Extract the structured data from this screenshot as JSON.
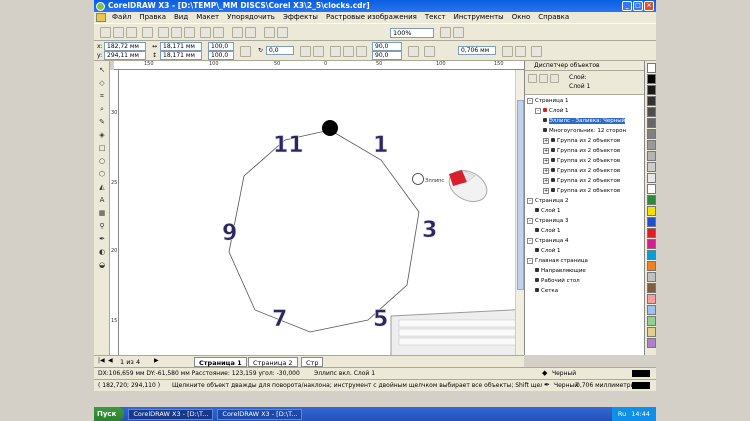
{
  "window": {
    "title": "CorelDRAW X3 - [D:\\TEMP\\_MM DISCS\\Corel X3\\2_5\\clocks.cdr]",
    "buttons": [
      "_",
      "□",
      "×"
    ]
  },
  "menu": [
    "Файл",
    "Правка",
    "Вид",
    "Макет",
    "Упорядочить",
    "Эффекты",
    "Растровые изображения",
    "Текст",
    "Инструменты",
    "Окно",
    "Справка"
  ],
  "toolbar": {
    "zoom": "100%"
  },
  "property_bar": {
    "x": "182,72 мм",
    "y": "294,11 мм",
    "w": "18,171 мм",
    "h": "18,171 мм",
    "scale_x": "100,0",
    "scale_y": "100,0",
    "rotation": "0,0",
    "start_angle": "90,0",
    "end_angle": "90,0",
    "outline_width": "0,706 мм"
  },
  "ruler": {
    "h_ticks": [
      "150",
      "100",
      "50",
      "0",
      "50",
      "100",
      "150"
    ],
    "v_ticks": [
      "30",
      "25",
      "20",
      "15"
    ],
    "unit": "миллиметры"
  },
  "canvas": {
    "numbers": [
      "11",
      "1",
      "3",
      "9",
      "7",
      "5"
    ],
    "cursor_label": "Эллипс"
  },
  "pages": {
    "nav": "1 из 4",
    "tabs": [
      "Страница 1",
      "Страница 2",
      "Стр"
    ]
  },
  "docker": {
    "title": "Диспетчер объектов",
    "layer_label": "Слой:",
    "layer_name": "Слой 1",
    "tree": [
      {
        "text": "Страница 1",
        "level": 0,
        "exp": "-"
      },
      {
        "text": "Слой 1",
        "level": 1,
        "exp": "-",
        "color": "#d02020"
      },
      {
        "text": "Эллипс - Заливка: Черный",
        "level": 2,
        "sel": true
      },
      {
        "text": "Многоугольник: 12 сторон",
        "level": 2
      },
      {
        "text": "Группа из 2 объектов",
        "level": 2,
        "exp": "+"
      },
      {
        "text": "Группа из 2 объектов",
        "level": 2,
        "exp": "+"
      },
      {
        "text": "Группа из 2 объектов",
        "level": 2,
        "exp": "+"
      },
      {
        "text": "Группа из 2 объектов",
        "level": 2,
        "exp": "+"
      },
      {
        "text": "Группа из 2 объектов",
        "level": 2,
        "exp": "+"
      },
      {
        "text": "Группа из 2 объектов",
        "level": 2,
        "exp": "+"
      },
      {
        "text": "Страница 2",
        "level": 0,
        "exp": "-"
      },
      {
        "text": "Слой 1",
        "level": 1
      },
      {
        "text": "Страница 3",
        "level": 0,
        "exp": "-"
      },
      {
        "text": "Слой 1",
        "level": 1
      },
      {
        "text": "Страница 4",
        "level": 0,
        "exp": "-"
      },
      {
        "text": "Слой 1",
        "level": 1
      },
      {
        "text": "Главная страница",
        "level": 0,
        "exp": "-"
      },
      {
        "text": "Направляющие",
        "level": 1
      },
      {
        "text": "Рабочий стол",
        "level": 1
      },
      {
        "text": "Сетка",
        "level": 1
      }
    ]
  },
  "palette": [
    "#ffffff",
    "#000000",
    "#1a1a1a",
    "#333333",
    "#4d4d4d",
    "#666666",
    "#808080",
    "#999999",
    "#b3b3b3",
    "#cccccc",
    "#e6e6e6",
    "#ffffff",
    "#2b8a3e",
    "#f5e000",
    "#1f4fd0",
    "#e02020",
    "#d51e8f",
    "#00a0e0",
    "#f08020",
    "#c0c0c0",
    "#7f5f3f",
    "#f4a0a0",
    "#a0c0f0",
    "#90d090",
    "#e0d090",
    "#b080d0"
  ],
  "status": {
    "line1_left": "DX:106,659 мм DY:-61,580 мм Расстояние: 123,159 угол: -30,000",
    "line1_mid": "Эллипс вкл. Слой 1",
    "fill_label": "Черный",
    "line2_left": "( 182,720; 294,110 )",
    "line2_hint": "Щелкните объект дважды для поворота/наклона; инструмент с двойным щелчком выбирает все объекты; Shift щелчок - выбор не...",
    "outline_label": "Черный",
    "outline_width": "0,706 миллиметры"
  },
  "taskbar": {
    "start": "Пуск",
    "items": [
      "CorelDRAW X3 - [D:\\T...",
      "CorelDRAW X3 - [D:\\T..."
    ],
    "lang": "Ru",
    "time": "14:44"
  }
}
